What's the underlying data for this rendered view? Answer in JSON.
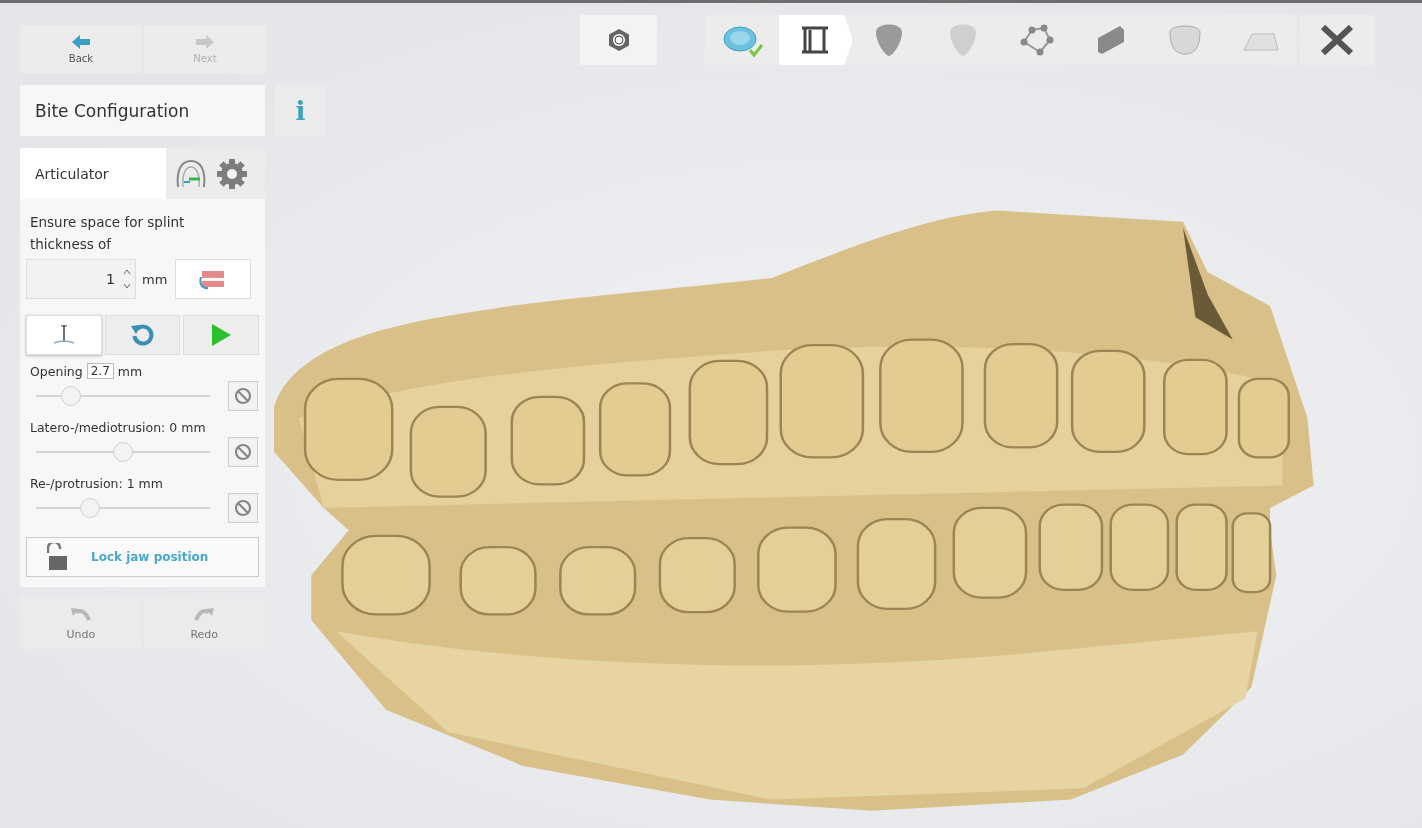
{
  "nav": [
    {
      "kind": "back",
      "label": "Back",
      "disabled": false
    },
    {
      "kind": "next",
      "label": "Next",
      "disabled": true
    }
  ],
  "title": "Bite Configuration",
  "info_button": "i",
  "tab": {
    "label": "Articulator",
    "selected": true
  },
  "splint": {
    "label": "Ensure space for splint thickness of",
    "value": "1",
    "unit": "mm"
  },
  "tools": [
    {
      "kind": "pin",
      "selected": true
    },
    {
      "kind": "reset",
      "selected": false
    },
    {
      "kind": "play",
      "selected": false
    }
  ],
  "sliders": [
    {
      "kind": "input",
      "label": "Opening",
      "value": "2.7",
      "unit": "mm",
      "level": 0.2
    },
    {
      "kind": "plain",
      "label": "Latero-/mediotrusion: 0 mm",
      "level": 0.5
    },
    {
      "kind": "plain",
      "label": "Re-/protrusion: 1 mm",
      "level": 0.31
    }
  ],
  "lock": {
    "label": "Lock jaw position",
    "locked": false
  },
  "history": [
    {
      "kind": "undo",
      "label": "Undo",
      "disabled": true
    },
    {
      "kind": "redo",
      "label": "Redo",
      "disabled": true
    }
  ],
  "steps": [
    {
      "kind": "scan",
      "selected": false,
      "done": true
    },
    {
      "kind": "articulator",
      "selected": true,
      "done": false
    },
    {
      "kind": "tooth",
      "selected": false,
      "done": false
    },
    {
      "kind": "tooth-light",
      "selected": false,
      "done": false
    },
    {
      "kind": "nodes",
      "selected": false,
      "done": false
    },
    {
      "kind": "bar",
      "selected": false,
      "done": false
    },
    {
      "kind": "crown",
      "selected": false,
      "done": false
    },
    {
      "kind": "plane",
      "selected": false,
      "done": false
    }
  ]
}
